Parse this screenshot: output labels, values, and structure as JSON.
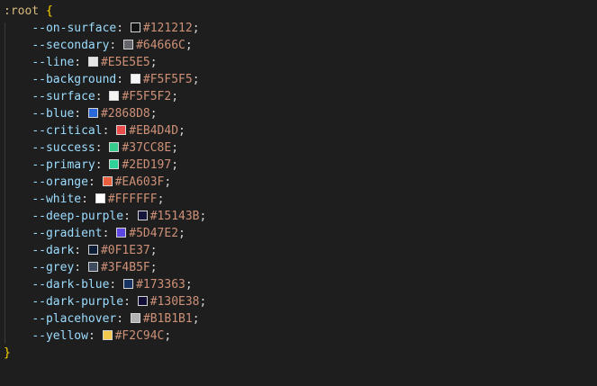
{
  "editor": {
    "selector": ":root",
    "open_brace": "{",
    "close_brace": "}",
    "variables": [
      {
        "name": "--on-surface",
        "value": "#121212",
        "color": "#121212"
      },
      {
        "name": "--secondary",
        "value": "#64666C",
        "color": "#64666C"
      },
      {
        "name": "--line",
        "value": "#E5E5E5",
        "color": "#E5E5E5"
      },
      {
        "name": "--background",
        "value": "#F5F5F5",
        "color": "#F5F5F5"
      },
      {
        "name": "--surface",
        "value": "#F5F5F2",
        "color": "#F5F5F2"
      },
      {
        "name": "--blue",
        "value": "#2868D8",
        "color": "#2868D8"
      },
      {
        "name": "--critical",
        "value": "#EB4D4D",
        "color": "#EB4D4D"
      },
      {
        "name": "--success",
        "value": "#37CC8E",
        "color": "#37CC8E"
      },
      {
        "name": "--primary",
        "value": "#2ED197",
        "color": "#2ED197"
      },
      {
        "name": "--orange",
        "value": "#EA603F",
        "color": "#EA603F"
      },
      {
        "name": "--white",
        "value": "#FFFFFF",
        "color": "#FFFFFF"
      },
      {
        "name": "--deep-purple",
        "value": "#15143B",
        "color": "#15143B"
      },
      {
        "name": "--gradient",
        "value": "#5D47E2",
        "color": "#5D47E2"
      },
      {
        "name": "--dark",
        "value": "#0F1E37",
        "color": "#0F1E37"
      },
      {
        "name": "--grey",
        "value": "#3F4B5F",
        "color": "#3F4B5F"
      },
      {
        "name": "--dark-blue",
        "value": "#173363",
        "color": "#173363"
      },
      {
        "name": "--dark-purple",
        "value": "#130E38",
        "color": "#130E38"
      },
      {
        "name": "--placehover",
        "value": "#B1B1B1",
        "color": "#B1B1B1"
      },
      {
        "name": "--yellow",
        "value": "#F2C94C",
        "color": "#F2C94C"
      }
    ]
  }
}
